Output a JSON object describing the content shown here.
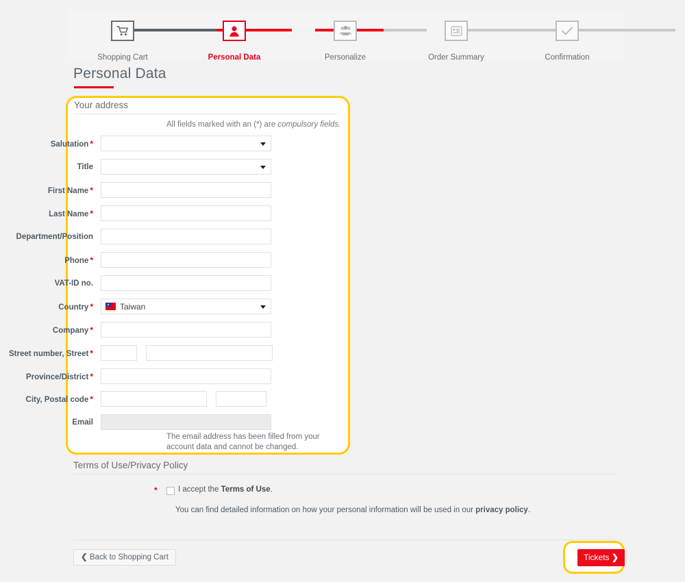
{
  "stepper": {
    "steps": [
      {
        "label": "Shopping Cart",
        "icon": "shopping-cart-icon",
        "state": "done"
      },
      {
        "label": "Personal Data",
        "icon": "person-icon",
        "state": "active"
      },
      {
        "label": "Personalize",
        "icon": "group-people-icon",
        "state": "upcoming"
      },
      {
        "label": "Order Summary",
        "icon": "list-document-icon",
        "state": "upcoming"
      },
      {
        "label": "Confirmation",
        "icon": "checkmark-icon",
        "state": "upcoming"
      }
    ]
  },
  "page": {
    "title": "Personal Data"
  },
  "address_panel": {
    "legend": "Your address",
    "compulsory_note_prefix": "All fields marked with an (*) are ",
    "compulsory_note_emphasis": "compulsory fields.",
    "required_marker": "*",
    "fields": {
      "salutation": {
        "label": "Salutation",
        "required": true,
        "type": "select",
        "value": ""
      },
      "title": {
        "label": "Title",
        "required": false,
        "type": "select",
        "value": ""
      },
      "first_name": {
        "label": "First Name",
        "required": true,
        "type": "text",
        "value": ""
      },
      "last_name": {
        "label": "Last Name",
        "required": true,
        "type": "text",
        "value": ""
      },
      "department": {
        "label": "Department/Position",
        "required": false,
        "type": "text",
        "value": ""
      },
      "phone": {
        "label": "Phone",
        "required": true,
        "type": "text",
        "value": ""
      },
      "vat_id": {
        "label": "VAT-ID no.",
        "required": false,
        "type": "text",
        "value": ""
      },
      "country": {
        "label": "Country",
        "required": true,
        "type": "select",
        "value": "Taiwan",
        "flag": "taiwan-flag-icon"
      },
      "company": {
        "label": "Company",
        "required": true,
        "type": "text",
        "value": ""
      },
      "street": {
        "label": "Street number, Street",
        "required": true,
        "type": "text-split",
        "value_number": "",
        "value_street": ""
      },
      "province": {
        "label": "Province/District",
        "required": true,
        "type": "text",
        "value": ""
      },
      "city_postal": {
        "label": "City, Postal code",
        "required": true,
        "type": "text-split",
        "value_city": "",
        "value_postal": ""
      },
      "email": {
        "label": "Email",
        "required": false,
        "type": "text",
        "value": "",
        "disabled": true,
        "help": "The email address has been filled from your account data and cannot be changed."
      }
    }
  },
  "terms": {
    "legend": "Terms of Use/Privacy Policy",
    "required_marker": "*",
    "accept_prefix": "I accept the ",
    "accept_link": "Terms of Use",
    "accept_suffix": ".",
    "checkbox_checked": false,
    "privacy_prefix": "You can find detailed information on how your personal information will be used in our ",
    "privacy_link": "privacy policy",
    "privacy_suffix": "."
  },
  "footer": {
    "back_label": "Back to Shopping Cart",
    "back_chevron": "❮",
    "tickets_label": "Tickets",
    "tickets_chevron": "❯"
  },
  "colors": {
    "accent_red": "#e2001a",
    "button_red": "#ee0a1a",
    "highlight_yellow": "#ffcc00",
    "page_bg": "#f2f2f2",
    "label_gray": "#4e5a63"
  }
}
